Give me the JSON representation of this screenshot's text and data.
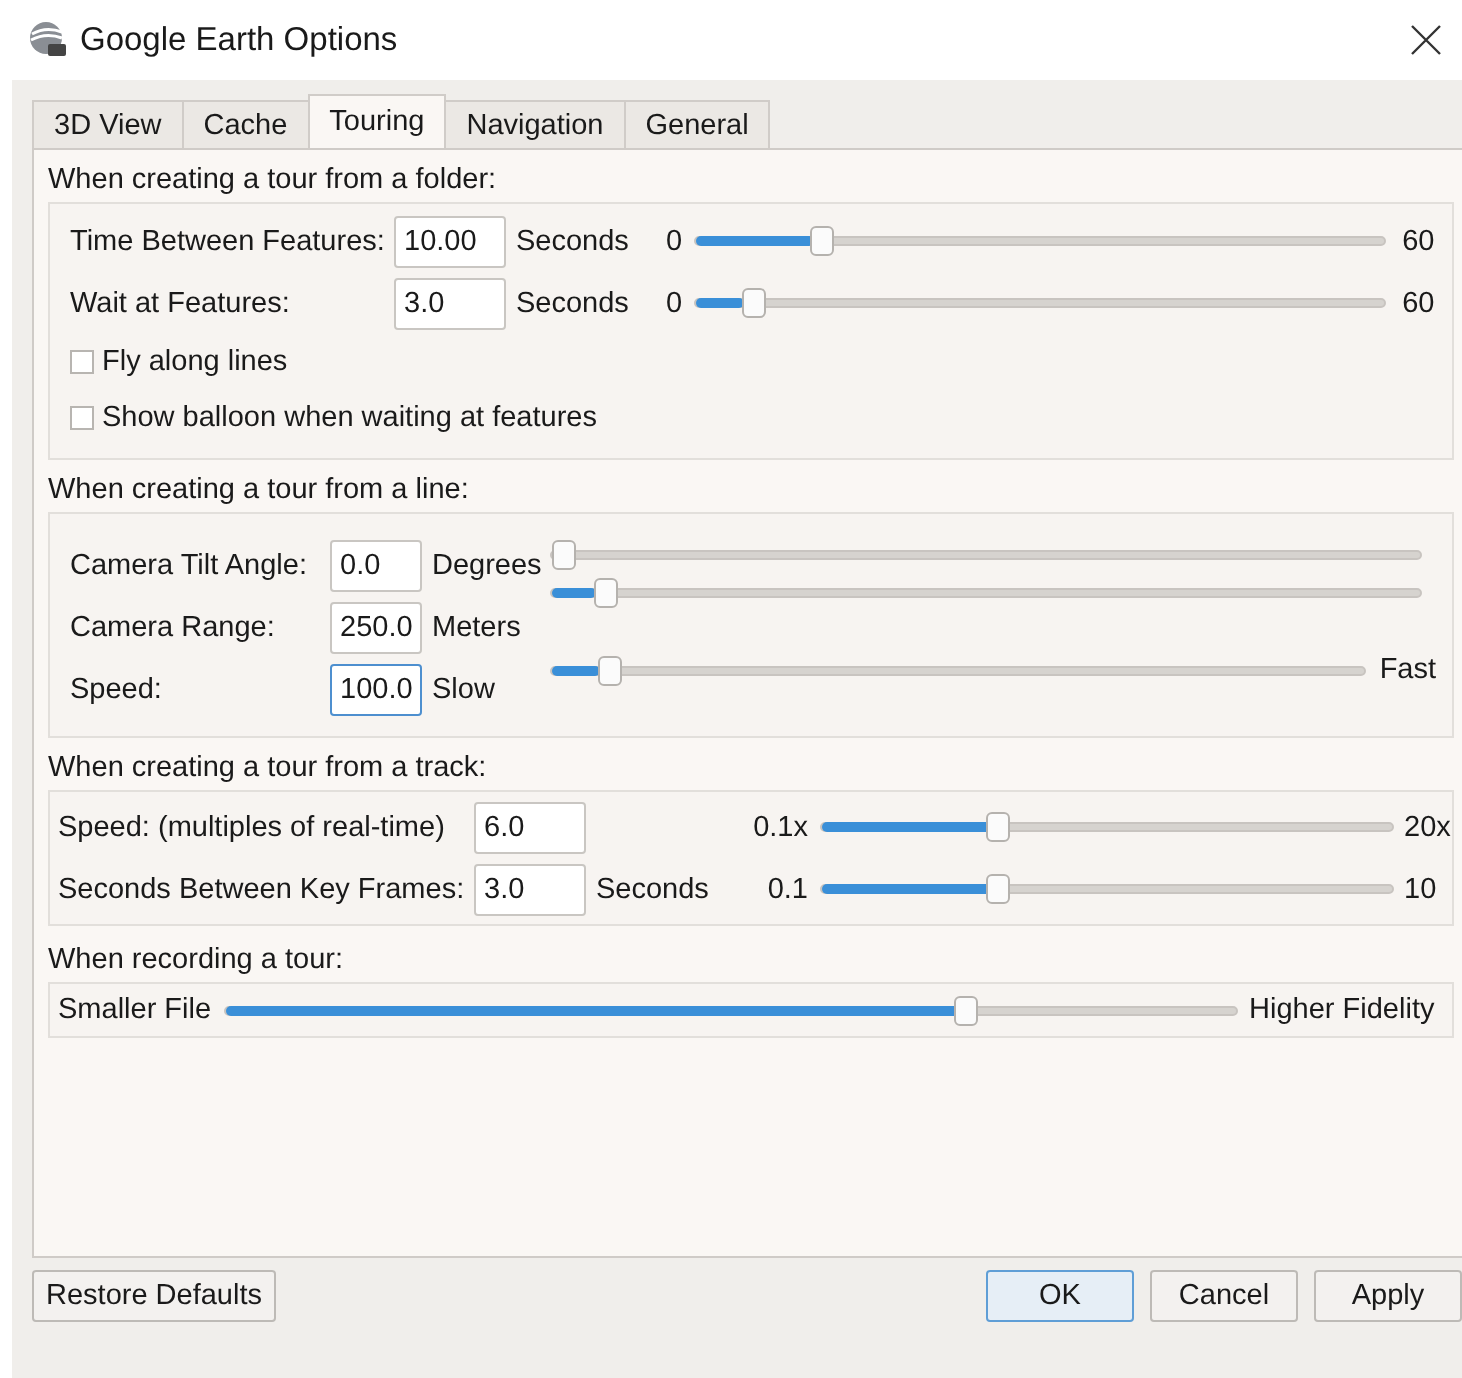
{
  "window": {
    "title": "Google Earth Options"
  },
  "tabs": [
    {
      "label": "3D View",
      "selected": false
    },
    {
      "label": "Cache",
      "selected": false
    },
    {
      "label": "Touring",
      "selected": true
    },
    {
      "label": "Navigation",
      "selected": false
    },
    {
      "label": "General",
      "selected": false
    }
  ],
  "folder": {
    "title": "When creating a tour from a folder:",
    "rows": [
      {
        "label": "Time Between Features:",
        "value": "10.00",
        "unit": "Seconds",
        "min": "0",
        "max": "60",
        "level": 0.17
      },
      {
        "label": "Wait at Features:",
        "value": "3.0",
        "unit": "Seconds",
        "min": "0",
        "max": "60",
        "level": 0.07
      }
    ],
    "checkboxes": [
      {
        "label": "Fly along lines",
        "checked": false
      },
      {
        "label": "Show balloon when waiting at features",
        "checked": false
      }
    ]
  },
  "line": {
    "title": "When creating a tour from a line:",
    "rows": [
      {
        "label": "Camera Tilt Angle:",
        "value": "0.0",
        "unit": "Degrees",
        "focused": false
      },
      {
        "label": "Camera Range:",
        "value": "250.0",
        "unit": "Meters",
        "focused": false
      },
      {
        "label": "Speed:",
        "value": "100.0",
        "unit": "Slow",
        "focused": true
      }
    ],
    "sliders": [
      {
        "level": 0
      },
      {
        "level": 0.05
      },
      {
        "level": 0.06,
        "end_label": "Fast"
      }
    ]
  },
  "track": {
    "title": "When creating a tour from a track:",
    "rows": [
      {
        "label": "Speed: (multiples of real-time)",
        "value": "6.0",
        "min": "0.1x",
        "max": "20x",
        "level": 0.3
      },
      {
        "label": "Seconds Between Key Frames:",
        "value": "3.0",
        "unit": "Seconds",
        "min": "0.1",
        "max": "10",
        "level": 0.3
      }
    ]
  },
  "recording": {
    "title": "When recording a tour:",
    "min": "Smaller File",
    "max": "Higher Fidelity",
    "level": 0.74
  },
  "buttons": [
    {
      "label": "Restore Defaults",
      "kind": "left",
      "default": false
    },
    {
      "label": "OK",
      "kind": "right",
      "default": true
    },
    {
      "label": "Cancel",
      "kind": "right",
      "default": false
    },
    {
      "label": "Apply",
      "kind": "right",
      "default": false
    }
  ]
}
